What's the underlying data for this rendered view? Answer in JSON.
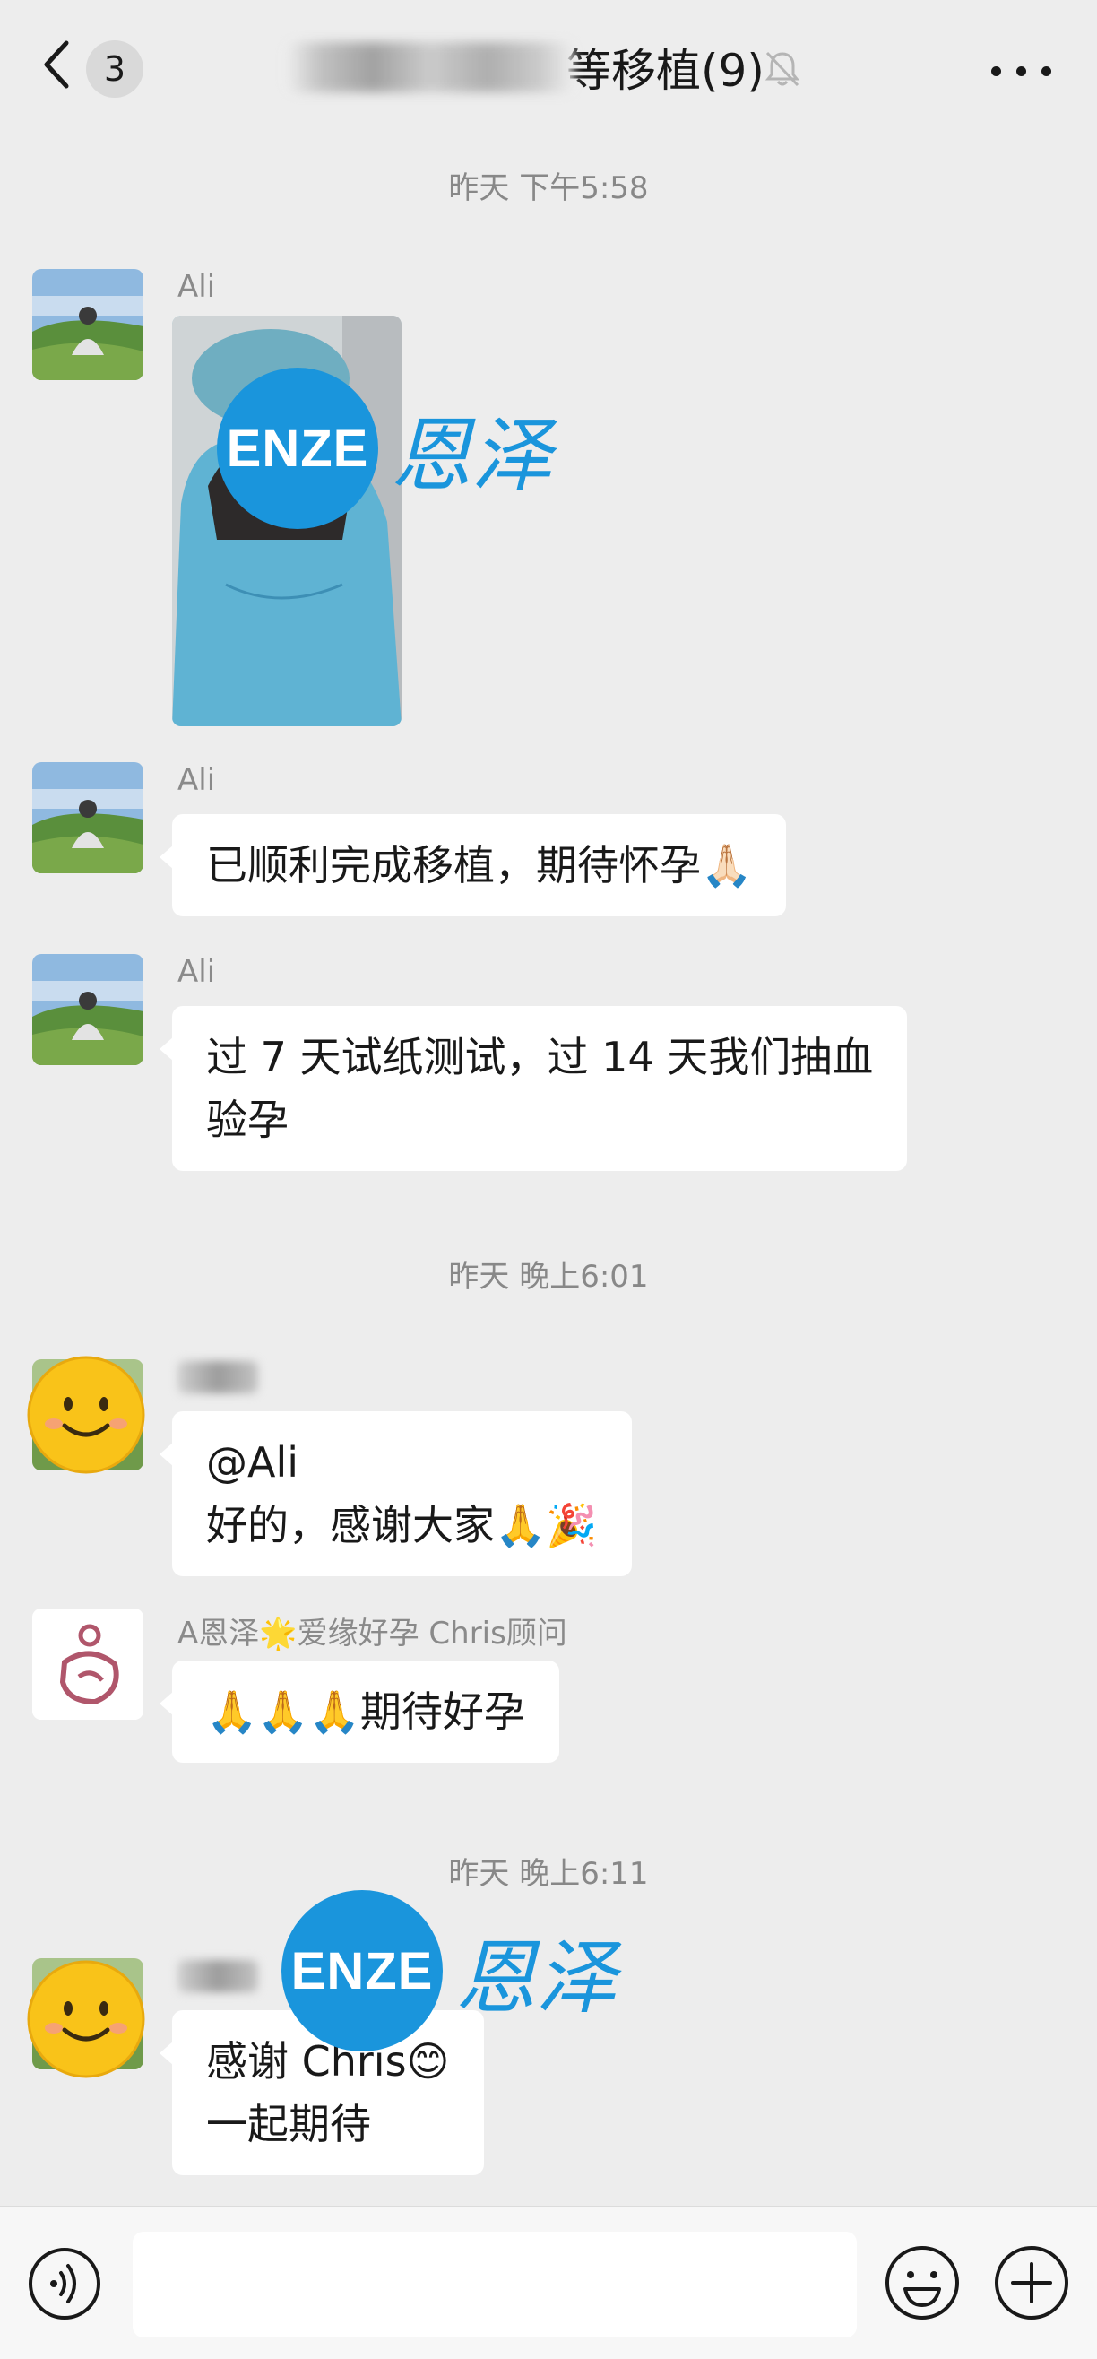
{
  "header": {
    "back_badge": "3",
    "title_visible": "等移植(9)"
  },
  "messages": [
    {
      "type": "time",
      "text": "昨天 下午5:58"
    },
    {
      "type": "image",
      "sender": "Ali"
    },
    {
      "type": "text",
      "sender": "Ali",
      "text": "已顺利完成移植，期待怀孕🙏🏻"
    },
    {
      "type": "text",
      "sender": "Ali",
      "lines": [
        "过 7 天试纸测试，过 14 天我们抽血",
        "验孕"
      ]
    },
    {
      "type": "time",
      "text": "昨天 晚上6:01"
    },
    {
      "type": "text",
      "sender": "",
      "lines": [
        "@Ali",
        "好的，感谢大家🙏🎉"
      ]
    },
    {
      "type": "text",
      "sender": "A恩泽🌟爱缘好孕 Chris顾问",
      "text": "🙏🙏🙏期待好孕"
    },
    {
      "type": "time",
      "text": "昨天 晚上6:11"
    },
    {
      "type": "text",
      "sender": "",
      "lines": [
        "感谢 Chris😊",
        "一起期待"
      ]
    }
  ],
  "watermark": {
    "logo_text": "ENZE",
    "cn_text": "恩泽",
    "color": "#1a95dc"
  },
  "colors": {
    "background": "#ededed",
    "bubble": "#ffffff",
    "meta_text": "#888888"
  }
}
